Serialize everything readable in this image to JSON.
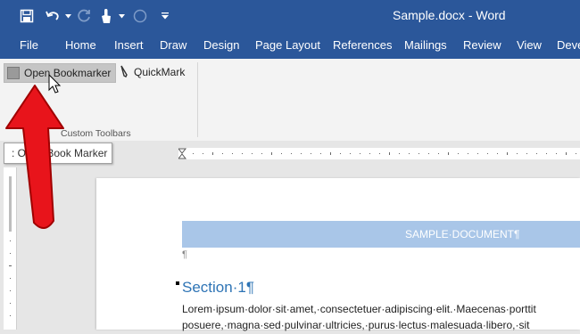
{
  "window": {
    "title": "Sample.docx - Word"
  },
  "quick_access_toolbar": {
    "items": [
      "save-icon",
      "undo-icon",
      "redo-icon",
      "touch-mode-icon",
      "circle-icon",
      "customize-qat-icon"
    ]
  },
  "ribbon_tabs": [
    "File",
    "Home",
    "Insert",
    "Draw",
    "Design",
    "Page Layout",
    "References",
    "Mailings",
    "Review",
    "View",
    "Deve"
  ],
  "ribbon": {
    "buttons": [
      {
        "label": "Open Bookmarker",
        "icon": "bookmark-icon",
        "state": "hover"
      },
      {
        "label": "QuickMark",
        "icon": "pencil-icon"
      }
    ],
    "group_label": "Custom Toolbars"
  },
  "tooltip": {
    "text": ": Open Book Marker"
  },
  "document": {
    "header_text": "SAMPLE·DOCUMENT¶",
    "empty_paragraph": "¶",
    "heading": "Section·1¶",
    "body_lines": [
      "Lorem·ipsum·dolor·sit·amet,·consectetuer·adipiscing·elit.·Maecenas·porttit",
      "posuere,·magna·sed·pulvinar·ultricies,·purus·lectus·malesuada·libero,·sit"
    ]
  },
  "colors": {
    "accent": "#2b579a",
    "heading": "#2e74b5",
    "header_band": "#a9c6e8",
    "annotation_arrow": "#e8141b"
  }
}
